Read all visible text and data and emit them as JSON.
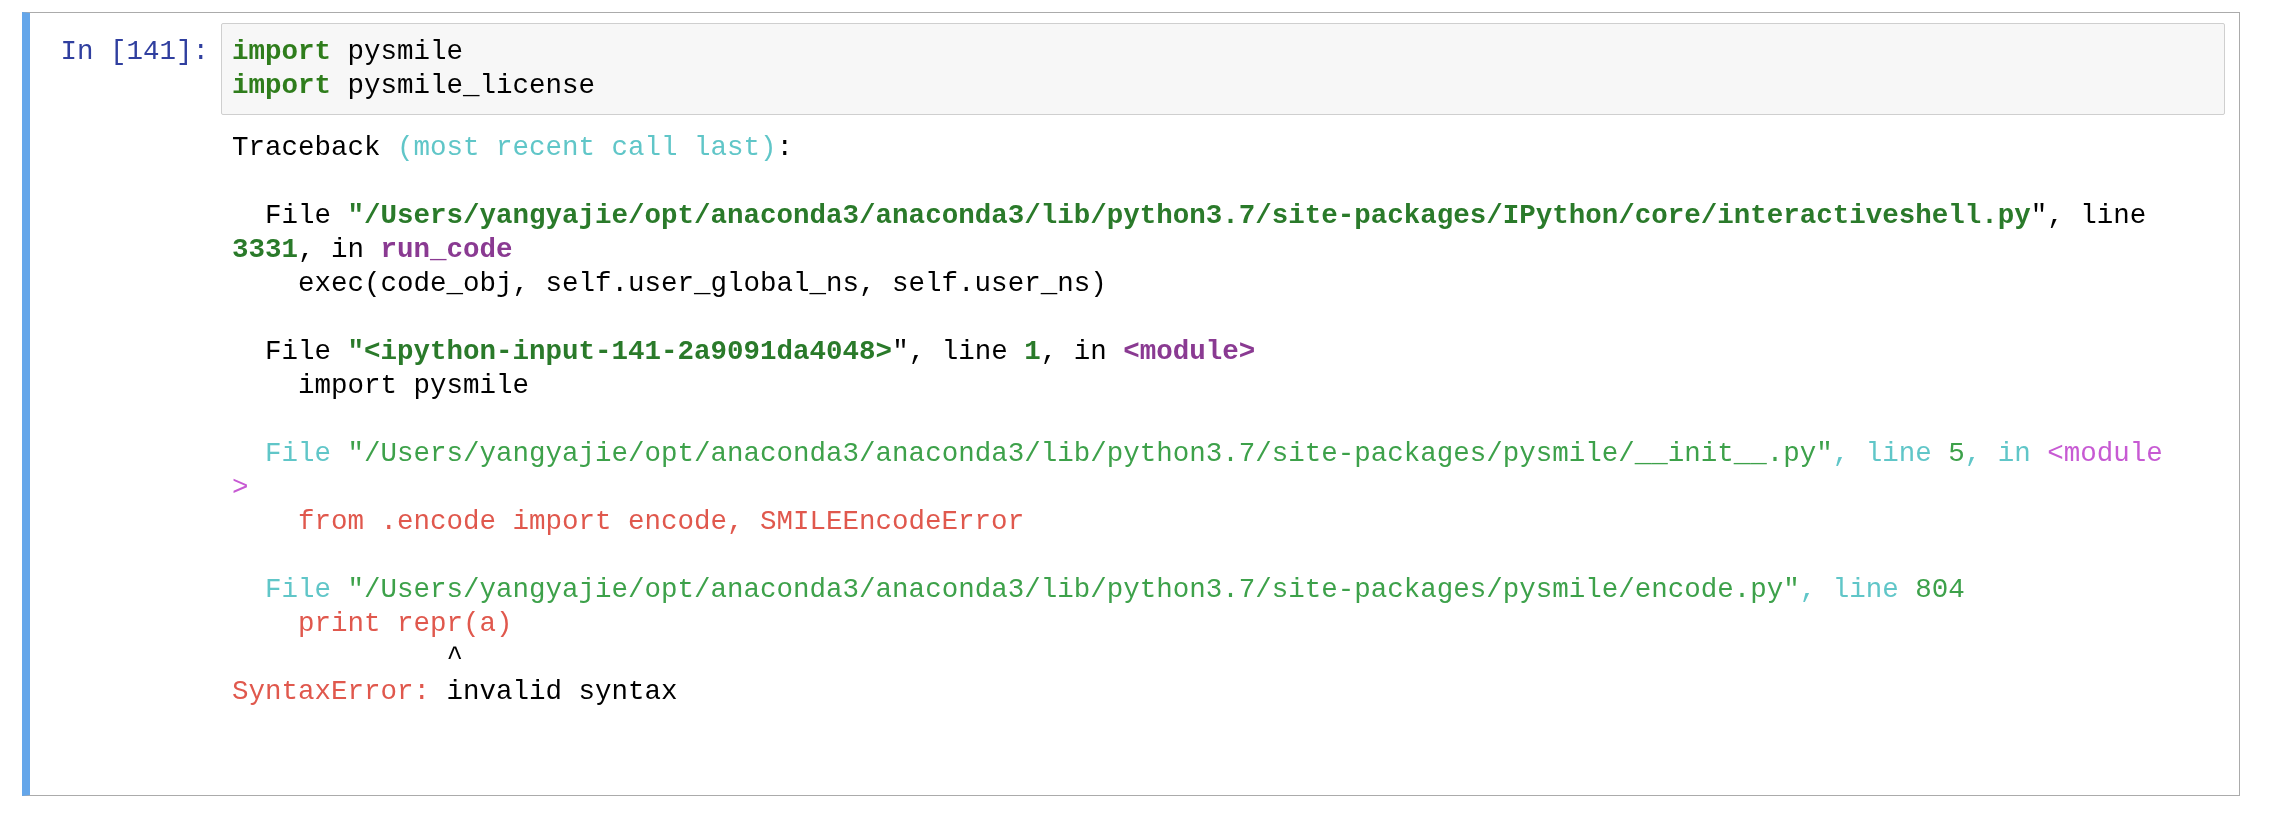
{
  "cell": {
    "prompt": "In [141]:",
    "selected": true,
    "input_lines": [
      [
        {
          "kind": "keyword",
          "text": "import"
        },
        {
          "kind": "plain",
          "text": " pysmile"
        }
      ],
      [
        {
          "kind": "keyword",
          "text": "import"
        },
        {
          "kind": "plain",
          "text": " pysmile_license"
        }
      ]
    ],
    "output_blocks": [
      {
        "lines": [
          [
            {
              "kind": "plain",
              "text": "Traceback "
            },
            {
              "kind": "note",
              "text": "(most recent call last)"
            },
            {
              "kind": "plain",
              "text": ":"
            }
          ]
        ]
      },
      {
        "lines": [
          [
            {
              "kind": "plain",
              "text": "  File "
            },
            {
              "kind": "path",
              "text": "\"/Users/yangyajie/opt/anaconda3/anaconda3/lib/python3.7/site-packages/IPython/core/interactiveshell.py"
            },
            {
              "kind": "plain",
              "text": "\", line"
            }
          ],
          [
            {
              "kind": "path",
              "text": "3331"
            },
            {
              "kind": "plain",
              "text": ", in "
            },
            {
              "kind": "symbol",
              "text": "run_code"
            }
          ],
          [
            {
              "kind": "plain",
              "text": "    exec(code_obj, self.user_global_ns, self.user_ns)"
            }
          ]
        ]
      },
      {
        "lines": [
          [
            {
              "kind": "plain",
              "text": "  File "
            },
            {
              "kind": "path",
              "text": "\"<ipython-input-141-2a9091da4048>"
            },
            {
              "kind": "plain",
              "text": "\", line "
            },
            {
              "kind": "path",
              "text": "1"
            },
            {
              "kind": "plain",
              "text": ", in "
            },
            {
              "kind": "symbol",
              "text": "<module>"
            }
          ],
          [
            {
              "kind": "plain",
              "text": "    import pysmile"
            }
          ]
        ]
      },
      {
        "lines": [
          [
            {
              "kind": "note",
              "text": "  File "
            },
            {
              "kind": "source",
              "text": "\"/Users/yangyajie/opt/anaconda3/anaconda3/lib/python3.7/site-packages/pysmile/__init__.py\""
            },
            {
              "kind": "note",
              "text": ", line "
            },
            {
              "kind": "source",
              "text": "5"
            },
            {
              "kind": "note",
              "text": ", in "
            },
            {
              "kind": "tag",
              "text": "<module"
            }
          ],
          [
            {
              "kind": "tag",
              "text": ">"
            }
          ],
          [
            {
              "kind": "error",
              "text": "    from .encode import encode, SMILEEncodeError"
            }
          ]
        ]
      },
      {
        "lines": [
          [
            {
              "kind": "note",
              "text": "  File "
            },
            {
              "kind": "source",
              "text": "\"/Users/yangyajie/opt/anaconda3/anaconda3/lib/python3.7/site-packages/pysmile/encode.py\""
            },
            {
              "kind": "note",
              "text": ", line "
            },
            {
              "kind": "source",
              "text": "804"
            }
          ],
          [
            {
              "kind": "error",
              "text": "    print repr(a)"
            }
          ],
          [
            {
              "kind": "plain",
              "text": "             ^"
            }
          ],
          [
            {
              "kind": "error",
              "text": "SyntaxError:"
            },
            {
              "kind": "plain",
              "text": " invalid syntax"
            }
          ]
        ]
      }
    ]
  }
}
